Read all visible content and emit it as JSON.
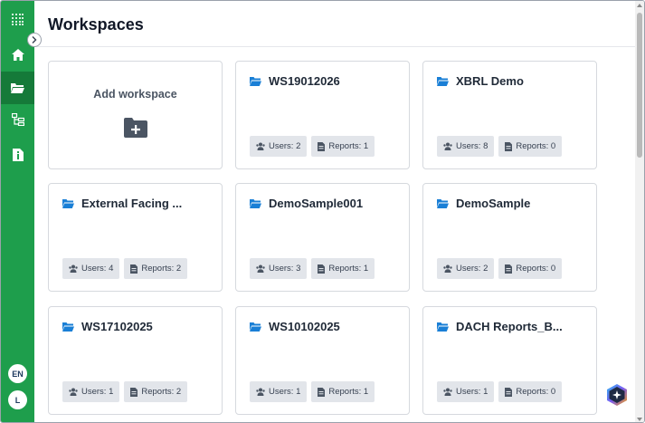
{
  "page": {
    "title": "Workspaces"
  },
  "sidebar": {
    "items": [
      {
        "name": "apps-grid",
        "icon": "grid-icon"
      },
      {
        "name": "home",
        "icon": "home-icon"
      },
      {
        "name": "workspaces",
        "icon": "folder-open-icon",
        "active": true
      },
      {
        "name": "hierarchy",
        "icon": "sitemap-icon"
      },
      {
        "name": "info",
        "icon": "info-icon"
      }
    ],
    "language": "EN",
    "user_initial": "L",
    "accent_color": "#1e9e4c",
    "active_color": "#157a39"
  },
  "add_workspace": {
    "label": "Add workspace",
    "icon": "folder-plus-icon"
  },
  "workspaces": [
    {
      "name": "WS19012026",
      "users": "Users: 2",
      "reports": "Reports: 1"
    },
    {
      "name": "XBRL Demo",
      "users": "Users: 8",
      "reports": "Reports: 0"
    },
    {
      "name": "External Facing ...",
      "users": "Users: 4",
      "reports": "Reports: 2"
    },
    {
      "name": "DemoSample001",
      "users": "Users: 3",
      "reports": "Reports: 1"
    },
    {
      "name": "DemoSample",
      "users": "Users: 2",
      "reports": "Reports: 0"
    },
    {
      "name": "WS17102025",
      "users": "Users: 1",
      "reports": "Reports: 2"
    },
    {
      "name": "WS10102025",
      "users": "Users: 1",
      "reports": "Reports: 1"
    },
    {
      "name": "DACH Reports_B...",
      "users": "Users: 1",
      "reports": "Reports: 0"
    }
  ],
  "colors": {
    "folder": "#1a7fd6",
    "pill_bg": "#e2e5ea"
  }
}
